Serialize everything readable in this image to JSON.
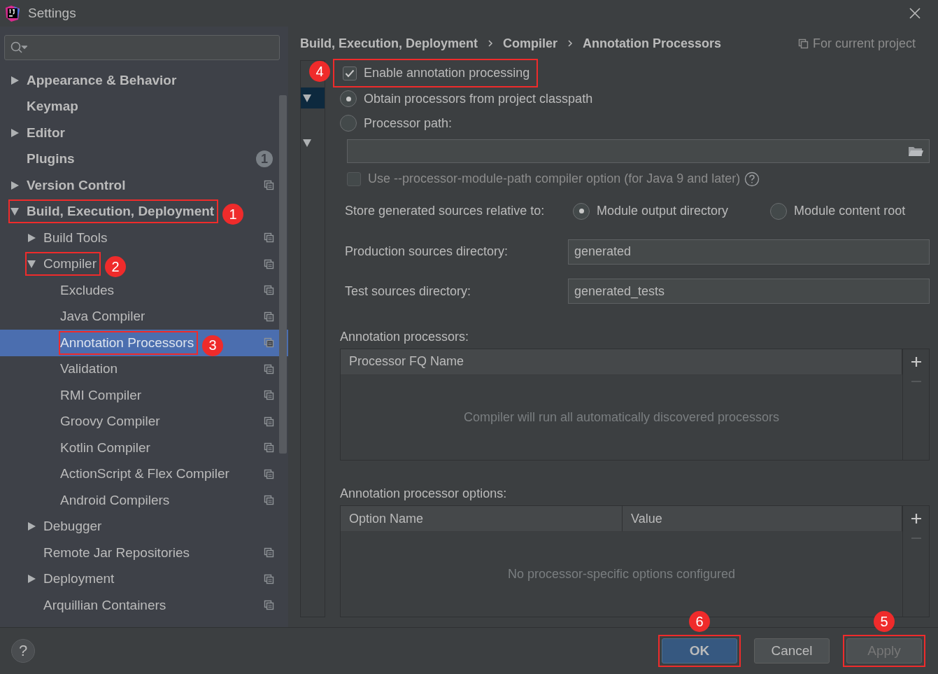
{
  "window": {
    "title": "Settings"
  },
  "sidebar": {
    "items": [
      {
        "label": "Appearance & Behavior",
        "expanded": false,
        "selected": false
      },
      {
        "label": "Keymap",
        "selected": false
      },
      {
        "label": "Editor",
        "expanded": false,
        "selected": false
      },
      {
        "label": "Plugins",
        "selected": false,
        "badge": "1"
      },
      {
        "label": "Version Control",
        "expanded": false,
        "selected": false,
        "project_level": true
      },
      {
        "label": "Build, Execution, Deployment",
        "expanded": true,
        "selected": false,
        "callout": "1",
        "children": [
          {
            "label": "Build Tools",
            "expanded": false,
            "selected": false,
            "project_level": true
          },
          {
            "label": "Compiler",
            "expanded": true,
            "selected": false,
            "project_level": true,
            "callout": "2",
            "children": [
              {
                "label": "Excludes",
                "selected": false,
                "project_level": true
              },
              {
                "label": "Java Compiler",
                "selected": false,
                "project_level": true
              },
              {
                "label": "Annotation Processors",
                "selected": true,
                "project_level": true,
                "callout": "3"
              },
              {
                "label": "Validation",
                "selected": false,
                "project_level": true
              },
              {
                "label": "RMI Compiler",
                "selected": false,
                "project_level": true
              },
              {
                "label": "Groovy Compiler",
                "selected": false,
                "project_level": true
              },
              {
                "label": "Kotlin Compiler",
                "selected": false,
                "project_level": true
              },
              {
                "label": "ActionScript & Flex Compiler",
                "selected": false,
                "project_level": true
              },
              {
                "label": "Android Compilers",
                "selected": false,
                "project_level": true
              }
            ]
          },
          {
            "label": "Debugger",
            "expanded": false,
            "selected": false
          },
          {
            "label": "Remote Jar Repositories",
            "selected": false,
            "project_level": true
          },
          {
            "label": "Deployment",
            "expanded": false,
            "selected": false,
            "project_level": true
          },
          {
            "label": "Arquillian Containers",
            "selected": false,
            "project_level": true
          }
        ]
      }
    ]
  },
  "content": {
    "breadcrumb": [
      "Build, Execution, Deployment",
      "Compiler",
      "Annotation Processors"
    ],
    "scope": "For current project",
    "profile_tree": [
      {
        "expanded": true,
        "selected": true
      },
      {
        "expanded": true,
        "selected": false
      }
    ],
    "enable": {
      "label": "Enable annotation processing",
      "checked": true,
      "callout": "4"
    },
    "sources": [
      {
        "label": "Obtain processors from project classpath",
        "selected": true
      },
      {
        "label": "Processor path:",
        "selected": false
      }
    ],
    "module_path": {
      "label": "Use --processor-module-path compiler option (for Java 9 and later)",
      "checked": false,
      "disabled": true
    },
    "store": {
      "label": "Store generated sources relative to:",
      "options": [
        {
          "label": "Module output directory",
          "selected": true
        },
        {
          "label": "Module content root",
          "selected": false
        }
      ]
    },
    "production": {
      "label": "Production sources directory:",
      "value": "generated"
    },
    "test": {
      "label": "Test sources directory:",
      "value": "generated_tests"
    },
    "processors": {
      "title": "Annotation processors:",
      "columns": [
        "Processor FQ Name"
      ],
      "empty_text": "Compiler will run all automatically discovered processors"
    },
    "options": {
      "title": "Annotation processor options:",
      "columns": [
        "Option Name",
        "Value"
      ],
      "empty_text": "No processor-specific options configured"
    }
  },
  "help_button": {
    "label": "?"
  },
  "buttons": [
    {
      "label": "OK",
      "kind": "default",
      "disabled": false,
      "callout": "6"
    },
    {
      "label": "Cancel",
      "kind": "normal",
      "disabled": false
    },
    {
      "label": "Apply",
      "kind": "normal",
      "disabled": true,
      "callout": "5"
    }
  ]
}
